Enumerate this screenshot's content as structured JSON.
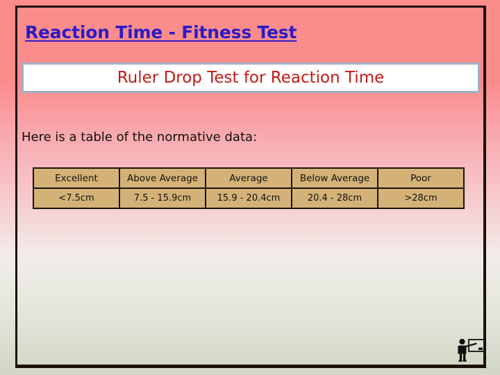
{
  "slide": {
    "title": "Reaction Time - Fitness Test",
    "subtitle": "Ruler Drop Test for Reaction Time",
    "body_text": "Here is a table of the normative data:",
    "colors": {
      "title_text": "#2B1BC4",
      "subtitle_text": "#C21B17",
      "subtitle_box_bg": "#FFFFFF",
      "subtitle_box_border": "#9FAFC4",
      "background_top": "#FB8C8C",
      "background_bottom": "#D2D6C4",
      "frame_border": "#1C1008",
      "table_cell_bg": "#D4B277",
      "table_border": "#1A1208",
      "body_text": "#12100C"
    }
  },
  "table": {
    "headers": [
      "Excellent",
      "Above Average",
      "Average",
      "Below Average",
      "Poor"
    ],
    "values": [
      "<7.5cm",
      "7.5 - 15.9cm",
      "15.9 - 20.4cm",
      "20.4 - 28cm",
      ">28cm"
    ]
  },
  "decorations": {
    "presenter_icon_name": "presenter-whiteboard-icon"
  }
}
